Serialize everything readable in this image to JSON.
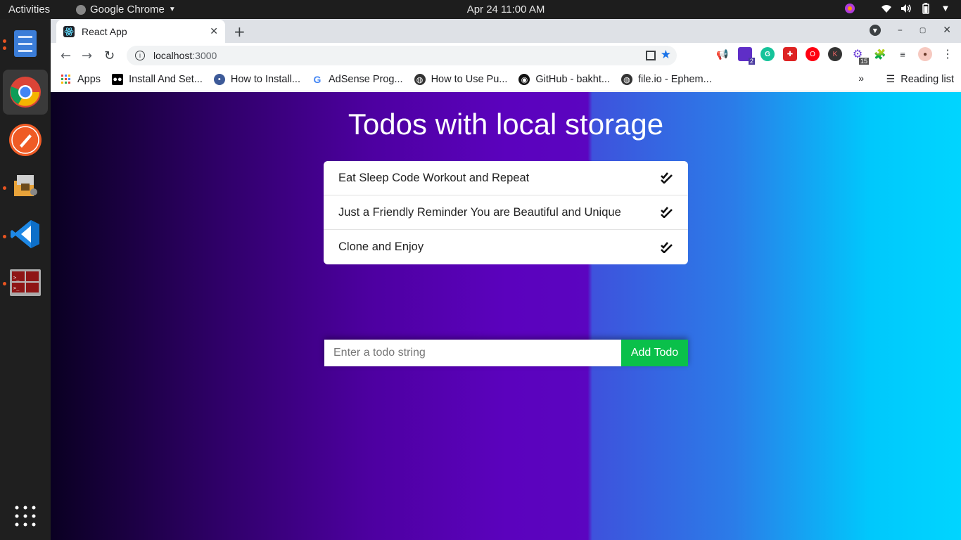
{
  "topbar": {
    "activities": "Activities",
    "app_name": "Google Chrome",
    "clock": "Apr 24  11:00 AM"
  },
  "browser": {
    "tab_title": "React App",
    "url_host": "localhost",
    "url_port": ":3000",
    "ext_badge_1": "2",
    "ext_badge_2": "15",
    "ext_k_label": "K"
  },
  "bookmarks": {
    "items": [
      {
        "label": "Apps",
        "icon": "apps-grid-icon"
      },
      {
        "label": "Install And Set...",
        "icon": "medium-icon"
      },
      {
        "label": "How to Install...",
        "icon": "site-icon"
      },
      {
        "label": "AdSense Prog...",
        "icon": "google-icon"
      },
      {
        "label": "How to Use Pu...",
        "icon": "globe-icon"
      },
      {
        "label": "GitHub - bakht...",
        "icon": "github-icon"
      },
      {
        "label": "file.io - Ephem...",
        "icon": "globe-icon"
      }
    ],
    "more": "»",
    "reading_list": "Reading list"
  },
  "app": {
    "title": "Todos with local storage",
    "todos": [
      {
        "text": "Eat Sleep Code Workout and Repeat"
      },
      {
        "text": "Just a Friendly Reminder You are Beautiful and Unique"
      },
      {
        "text": "Clone and Enjoy"
      }
    ],
    "input_placeholder": "Enter a todo string",
    "add_button": "Add Todo"
  },
  "colors": {
    "accent_green": "#0ac04a",
    "gradient_left": "#0a0022",
    "gradient_mid": "#5b02bd",
    "gradient_right": "#00d5ff"
  }
}
